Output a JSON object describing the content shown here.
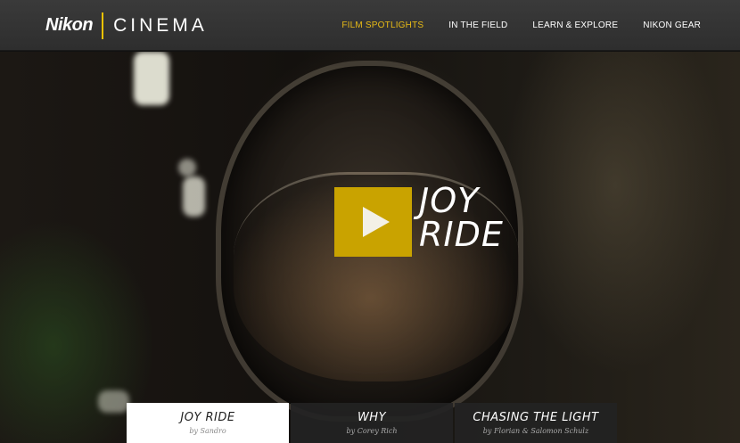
{
  "header": {
    "logo": "Nikon",
    "sub": "CINEMA",
    "nav": [
      {
        "label": "FILM SPOTLIGHTS",
        "active": true
      },
      {
        "label": "IN THE FIELD",
        "active": false
      },
      {
        "label": "LEARN & EXPLORE",
        "active": false
      },
      {
        "label": "NIKON GEAR",
        "active": false
      }
    ]
  },
  "hero": {
    "title_line1": "JOY",
    "title_line2": "RIDE",
    "play_icon": "play-icon"
  },
  "tabs": [
    {
      "title": "JOY RIDE",
      "by": "by Sandro",
      "active": true
    },
    {
      "title": "WHY",
      "by": "by Corey Rich",
      "active": false
    },
    {
      "title": "CHASING THE LIGHT",
      "by": "by Florian & Salomon Schulz",
      "active": false
    }
  ],
  "colors": {
    "accent": "#e8bb16",
    "play_bg": "#c9a300",
    "header_bg": "#333333"
  }
}
